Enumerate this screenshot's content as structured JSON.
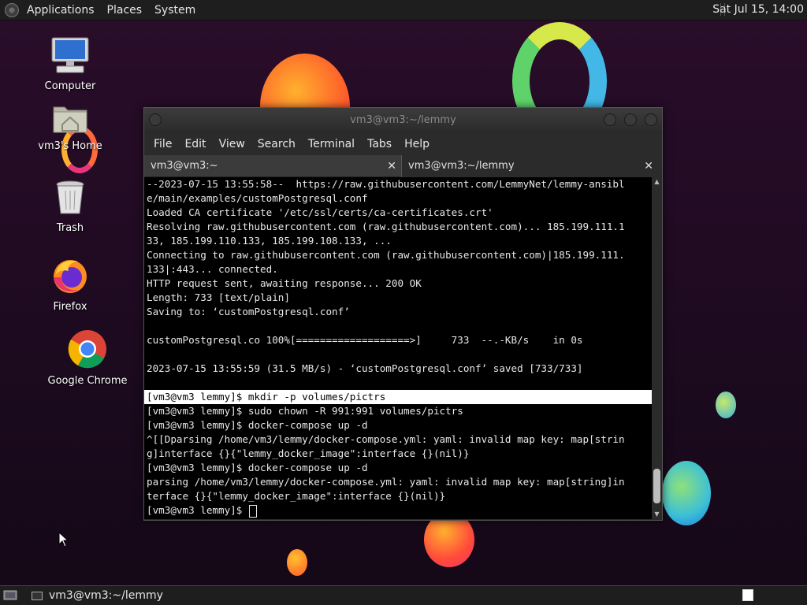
{
  "top_panel": {
    "menus": [
      "Applications",
      "Places",
      "System"
    ],
    "clock": "Sat Jul 15, 14:00"
  },
  "desktop_icons": [
    {
      "label": "Computer",
      "icon": "computer-icon"
    },
    {
      "label": "vm3's Home",
      "icon": "home-folder-icon"
    },
    {
      "label": "Trash",
      "icon": "trash-icon"
    },
    {
      "label": "Firefox",
      "icon": "firefox-icon"
    },
    {
      "label": "Google Chrome",
      "icon": "chrome-icon"
    }
  ],
  "window": {
    "title": "vm3@vm3:~/lemmy",
    "menus": [
      "File",
      "Edit",
      "View",
      "Search",
      "Terminal",
      "Tabs",
      "Help"
    ],
    "tabs": [
      {
        "label": "vm3@vm3:~",
        "active": false
      },
      {
        "label": "vm3@vm3:~/lemmy",
        "active": true
      }
    ]
  },
  "terminal": {
    "lines": [
      "--2023-07-15 13:55:58--  https://raw.githubusercontent.com/LemmyNet/lemmy-ansibl",
      "e/main/examples/customPostgresql.conf",
      "Loaded CA certificate '/etc/ssl/certs/ca-certificates.crt'",
      "Resolving raw.githubusercontent.com (raw.githubusercontent.com)... 185.199.111.1",
      "33, 185.199.110.133, 185.199.108.133, ...",
      "Connecting to raw.githubusercontent.com (raw.githubusercontent.com)|185.199.111.",
      "133|:443... connected.",
      "HTTP request sent, awaiting response... 200 OK",
      "Length: 733 [text/plain]",
      "Saving to: ‘customPostgresql.conf’",
      "",
      "customPostgresql.co 100%[===================>]     733  --.-KB/s    in 0s",
      "",
      "2023-07-15 13:55:59 (31.5 MB/s) - ‘customPostgresql.conf’ saved [733/733]",
      "",
      "[vm3@vm3 lemmy]$ mkdir -p volumes/pictrs",
      "[vm3@vm3 lemmy]$ sudo chown -R 991:991 volumes/pictrs",
      "[vm3@vm3 lemmy]$ docker-compose up -d",
      "^[[Dparsing /home/vm3/lemmy/docker-compose.yml: yaml: invalid map key: map[strin",
      "g]interface {}{\"lemmy_docker_image\":interface {}(nil)}",
      "[vm3@vm3 lemmy]$ docker-compose up -d",
      "parsing /home/vm3/lemmy/docker-compose.yml: yaml: invalid map key: map[string]in",
      "terface {}{\"lemmy_docker_image\":interface {}(nil)}",
      "[vm3@vm3 lemmy]$ "
    ],
    "highlighted_line": 15
  },
  "bottom_panel": {
    "task_label": "vm3@vm3:~/lemmy"
  }
}
